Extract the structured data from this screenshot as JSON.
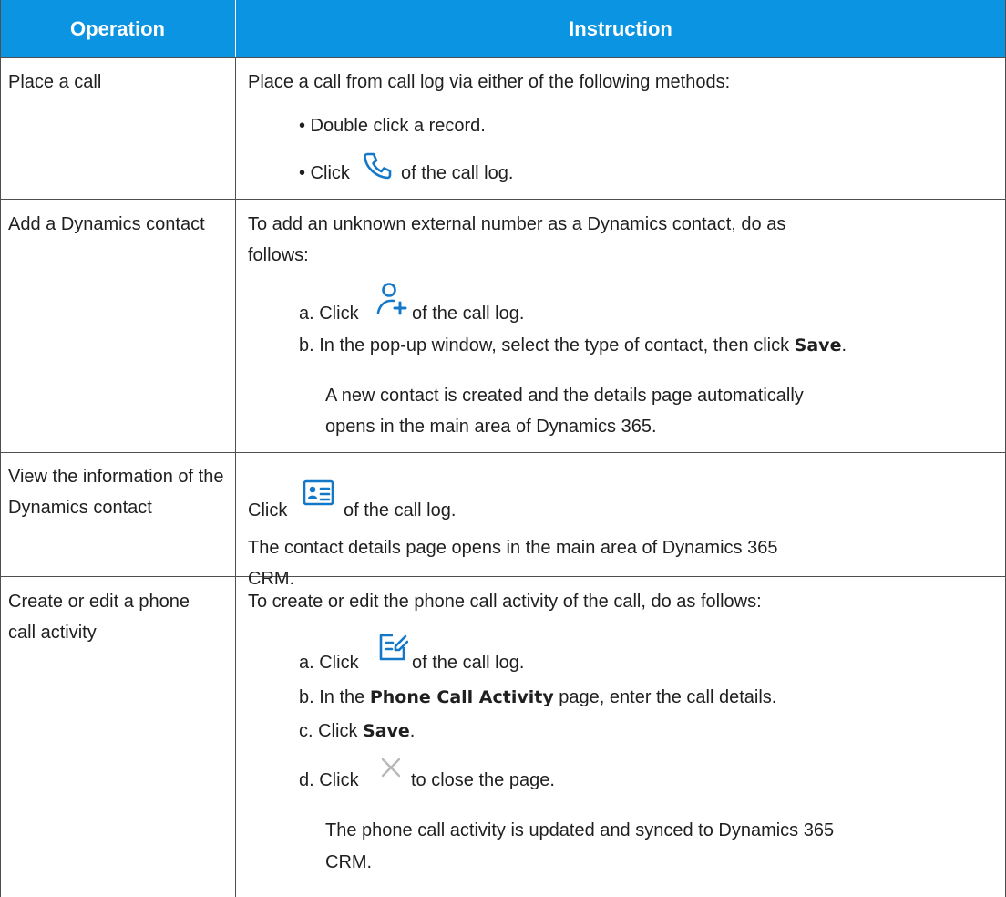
{
  "table": {
    "headers": {
      "operation": "Operation",
      "instruction": "Instruction"
    },
    "colors": {
      "header_bg": "#0a94e2",
      "icon": "#1478c8",
      "close_icon": "#b8b8b8",
      "border": "#4f4f4f"
    },
    "rows": [
      {
        "operation": "Place a call",
        "intro": "Place a call from call log via either of the following methods:",
        "bullet1": "• Double click a record.",
        "bullet2_pre": "• Click",
        "bullet2_icon": "phone-icon",
        "bullet2_post": "of the call log."
      },
      {
        "operation": "Add a Dynamics contact",
        "intro_line1": "To add an unknown external number as a Dynamics contact, do as",
        "intro_line2": "follows:",
        "step_a_pre": "a. Click",
        "step_a_icon": "add-contact-icon",
        "step_a_post": "of the call log.",
        "step_b_pre": "b. In the pop-up window, select the type of contact, then click",
        "step_b_bold": "Save",
        "step_b_post": ".",
        "note_line1": "A new contact is created and the details page automatically",
        "note_line2": "opens in the main area of Dynamics 365."
      },
      {
        "operation": "View the information of the Dynamics contact",
        "click_pre": "Click",
        "click_icon": "contact-card-icon",
        "click_post": "of the call log.",
        "note_line1": "The contact details page opens in the main area of Dynamics 365",
        "note_line2": "CRM."
      },
      {
        "operation": "Create or edit a phone call activity",
        "intro": "To create or edit the phone call activity of the call, do as follows:",
        "step_a_pre": "a. Click",
        "step_a_icon": "edit-note-icon",
        "step_a_post": "of the call log.",
        "step_b_pre": "b. In the",
        "step_b_bold": "Phone Call Activity",
        "step_b_post": "page, enter the call details.",
        "step_c_pre": "c. Click",
        "step_c_bold": "Save",
        "step_c_post": ".",
        "step_d_pre": "d. Click",
        "step_d_icon": "close-icon",
        "step_d_post": "to close the page.",
        "note_line1": "The phone call activity is updated and synced to Dynamics 365",
        "note_line2": "CRM."
      }
    ]
  }
}
